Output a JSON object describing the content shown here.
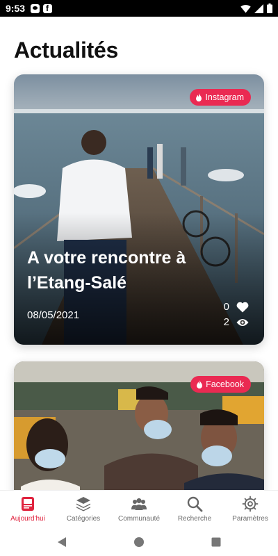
{
  "status_bar": {
    "time": "9:53",
    "left_icons": [
      "message-icon",
      "facebook-icon"
    ],
    "right_icons": [
      "wifi-icon",
      "signal-icon",
      "battery-icon"
    ]
  },
  "page": {
    "title": "Actualités"
  },
  "cards": [
    {
      "source": "Instagram",
      "title": "A votre rencontre à l’Etang-Salé",
      "date": "08/05/2021",
      "likes": "0",
      "views": "2"
    },
    {
      "source": "Facebook"
    }
  ],
  "bottom_nav": {
    "items": [
      {
        "label": "Aujourd'hui",
        "icon": "today-icon",
        "active": true
      },
      {
        "label": "Catégories",
        "icon": "layers-icon",
        "active": false
      },
      {
        "label": "Communauté",
        "icon": "people-icon",
        "active": false
      },
      {
        "label": "Recherche",
        "icon": "search-icon",
        "active": false
      },
      {
        "label": "Paramètres",
        "icon": "gear-icon",
        "active": false
      }
    ]
  },
  "colors": {
    "accent": "#e0243f",
    "badge": "#ea2a52",
    "inactive": "#6b6b6b"
  }
}
